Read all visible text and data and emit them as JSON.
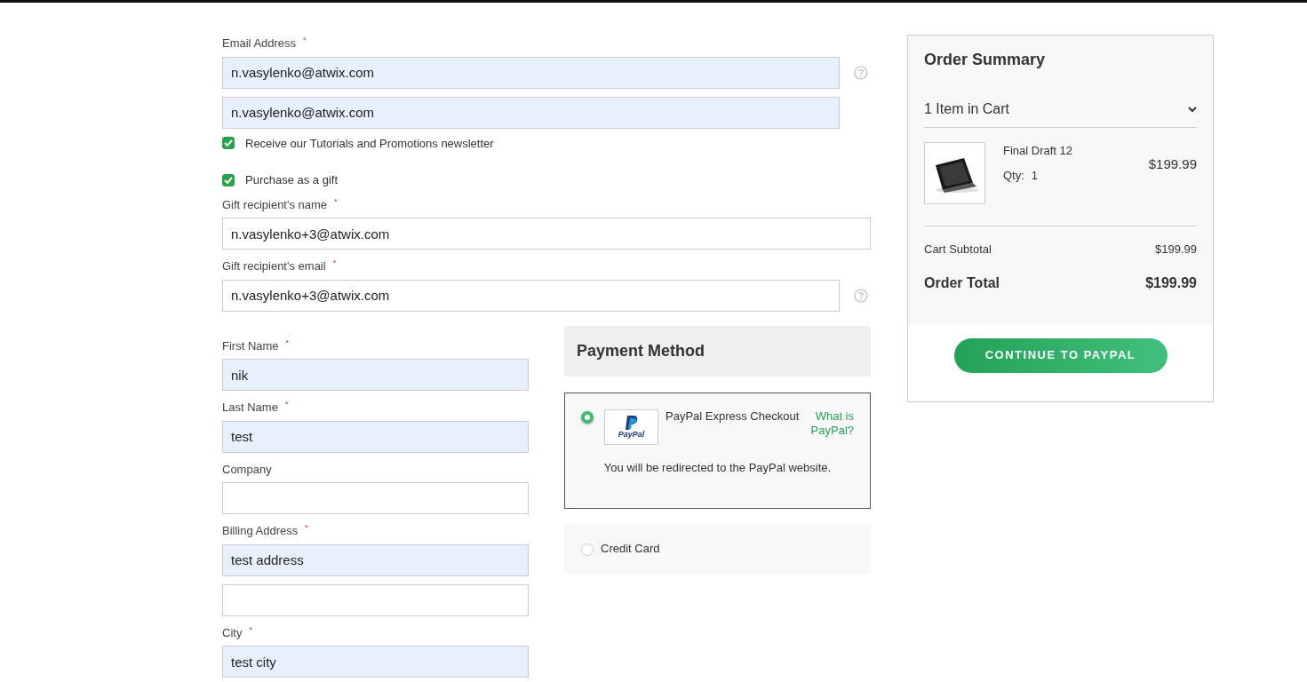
{
  "contact_fields": [
    {
      "kind": "input",
      "label": "Email Address",
      "required_mark": "*",
      "help": true,
      "inputs": [
        {
          "value": "n.vasylenko@atwix.com",
          "autofilled": true
        },
        {
          "value": "n.vasylenko@atwix.com",
          "autofilled": true
        }
      ]
    },
    {
      "kind": "checkbox",
      "label": "Receive our Tutorials and Promotions newsletter",
      "checked": true
    },
    {
      "kind": "checkbox",
      "label": "Purchase as a gift",
      "checked": true
    },
    {
      "kind": "input",
      "label": "Gift recipient's name",
      "required_mark": "*",
      "help": false,
      "inputs": [
        {
          "value": "n.vasylenko+3@atwix.com",
          "autofilled": false
        }
      ]
    },
    {
      "kind": "input",
      "label": "Gift recipient's email",
      "required_mark": "*",
      "help": true,
      "inputs": [
        {
          "value": "n.vasylenko+3@atwix.com",
          "autofilled": false
        }
      ]
    }
  ],
  "address_fields": [
    {
      "kind": "input",
      "label": "First Name",
      "required_mark": "*",
      "help": false,
      "inputs": [
        {
          "value": "nik",
          "autofilled": true
        }
      ]
    },
    {
      "kind": "input",
      "label": "Last Name",
      "required_mark": "*",
      "help": false,
      "inputs": [
        {
          "value": "test",
          "autofilled": true
        }
      ]
    },
    {
      "kind": "input",
      "label": "Company",
      "help": false,
      "inputs": [
        {
          "autofilled": false
        }
      ]
    },
    {
      "kind": "input",
      "label": "Billing Address",
      "required_mark": "*",
      "help": false,
      "inputs": [
        {
          "value": "test address",
          "autofilled": true
        },
        {
          "autofilled": false
        }
      ]
    },
    {
      "kind": "input",
      "label": "City",
      "required_mark": "*",
      "help": false,
      "inputs": [
        {
          "value": "test city",
          "autofilled": true
        }
      ]
    }
  ],
  "payment": {
    "title": "Payment Method",
    "methods": [
      {
        "label": "PayPal Express Checkout",
        "selected": true,
        "logo_text": "PayPal",
        "link": "What is PayPal?",
        "note": "You will be redirected to the PayPal website."
      },
      {
        "label": "Credit Card",
        "selected": false
      }
    ]
  },
  "order_summary": {
    "title": "Order Summary",
    "cart_count": "1 Item in Cart",
    "items": [
      {
        "name": "Final Draft 12",
        "qty_label": "Qty:",
        "qty": "1",
        "price": "$199.99"
      }
    ],
    "subtotal_label": "Cart Subtotal",
    "subtotal": "$199.99",
    "total_label": "Order Total",
    "total": "$199.99",
    "button": "CONTINUE TO PAYPAL"
  }
}
